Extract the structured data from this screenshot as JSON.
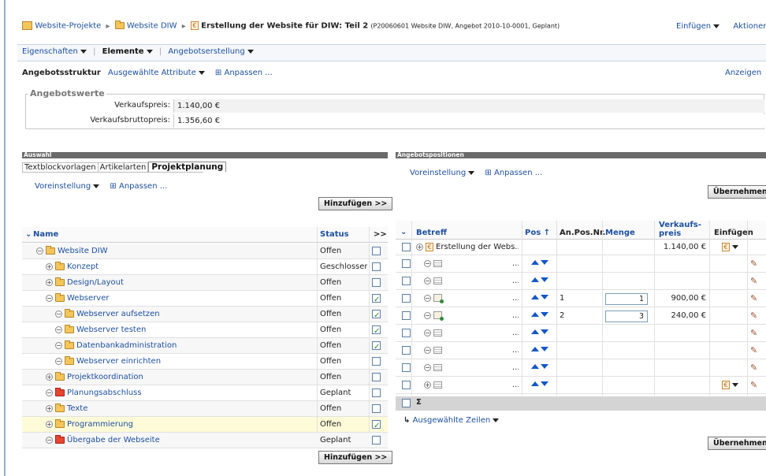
{
  "breadcrumb": {
    "items": [
      "Website-Projekte",
      "Website DIW"
    ],
    "current": "Erstellung der Website für DIW: Teil 2",
    "meta": "(P20060601 Website DIW, Angebot 2010-10-0001, Geplant)"
  },
  "topActions": {
    "insert": "Einfügen",
    "actions": "Aktionen"
  },
  "tabs": [
    "Eigenschaften",
    "Elemente",
    "Angebotserstellung"
  ],
  "subnav": {
    "structure": "Angebotsstruktur",
    "attributes": "Ausgewählte Attribute",
    "customize": "Anpassen ...",
    "show": "Anzeigen"
  },
  "values": {
    "legend": "Angebotswerte",
    "sale_label": "Verkaufspreis:",
    "sale_value": "1.140,00 €",
    "gross_label": "Verkaufsbruttopreis:",
    "gross_value": "1.356,60 €"
  },
  "left": {
    "section": "Auswahl",
    "tabs": [
      "Textblockvorlagen",
      "Artikelarten",
      "Projektplanung"
    ],
    "preset": "Voreinstellung",
    "customize": "Anpassen ...",
    "add_button": "Hinzufügen >>",
    "col_name": "Name",
    "col_status": "Status",
    "col_move": ">>",
    "rows": [
      {
        "name": "Website DIW",
        "status": "Offen",
        "checked": false
      },
      {
        "name": "Konzept",
        "status": "Geschlossen",
        "checked": false
      },
      {
        "name": "Design/Layout",
        "status": "Offen",
        "checked": false
      },
      {
        "name": "Webserver",
        "status": "Offen",
        "checked": true
      },
      {
        "name": "Webserver aufsetzen",
        "status": "Offen",
        "checked": true
      },
      {
        "name": "Webserver testen",
        "status": "Offen",
        "checked": true
      },
      {
        "name": "Datenbankadministration",
        "status": "Offen",
        "checked": true
      },
      {
        "name": "Webserver einrichten",
        "status": "Offen",
        "checked": false
      },
      {
        "name": "Projektkoordination",
        "status": "Offen",
        "checked": false
      },
      {
        "name": "Planungsabschluss",
        "status": "Geplant",
        "checked": false
      },
      {
        "name": "Texte",
        "status": "Offen",
        "checked": false
      },
      {
        "name": "Programmierung",
        "status": "Offen",
        "checked": true
      },
      {
        "name": "Übergabe der Webseite",
        "status": "Geplant",
        "checked": false
      }
    ]
  },
  "right": {
    "section": "Angebotspositionen",
    "preset": "Voreinstellung",
    "customize": "Anpassen ...",
    "apply_button": "Übernehmen",
    "col_subject": "Betreff",
    "col_pos": "Pos",
    "col_anpos": "An.Pos.Nr.",
    "col_qty": "Menge",
    "col_price_1": "Verkaufs-",
    "col_price_2": "preis",
    "col_insert": "Einfügen",
    "ellipsis": "...",
    "first_subject": "Erstellung der Webs...",
    "first_price": "1.140,00 €",
    "rows": [
      {
        "anpos": "",
        "qty": "",
        "price": ""
      },
      {
        "anpos": "",
        "qty": "",
        "price": ""
      },
      {
        "anpos": "1",
        "qty": "1",
        "price": "900,00 €"
      },
      {
        "anpos": "2",
        "qty": "3",
        "price": "240,00 €"
      },
      {
        "anpos": "",
        "qty": "",
        "price": ""
      },
      {
        "anpos": "",
        "qty": "",
        "price": ""
      },
      {
        "anpos": "",
        "qty": "",
        "price": ""
      },
      {
        "anpos": "",
        "qty": "",
        "price": ""
      }
    ],
    "sum": "Σ",
    "selected_rows": "Ausgewählte Zeilen"
  }
}
